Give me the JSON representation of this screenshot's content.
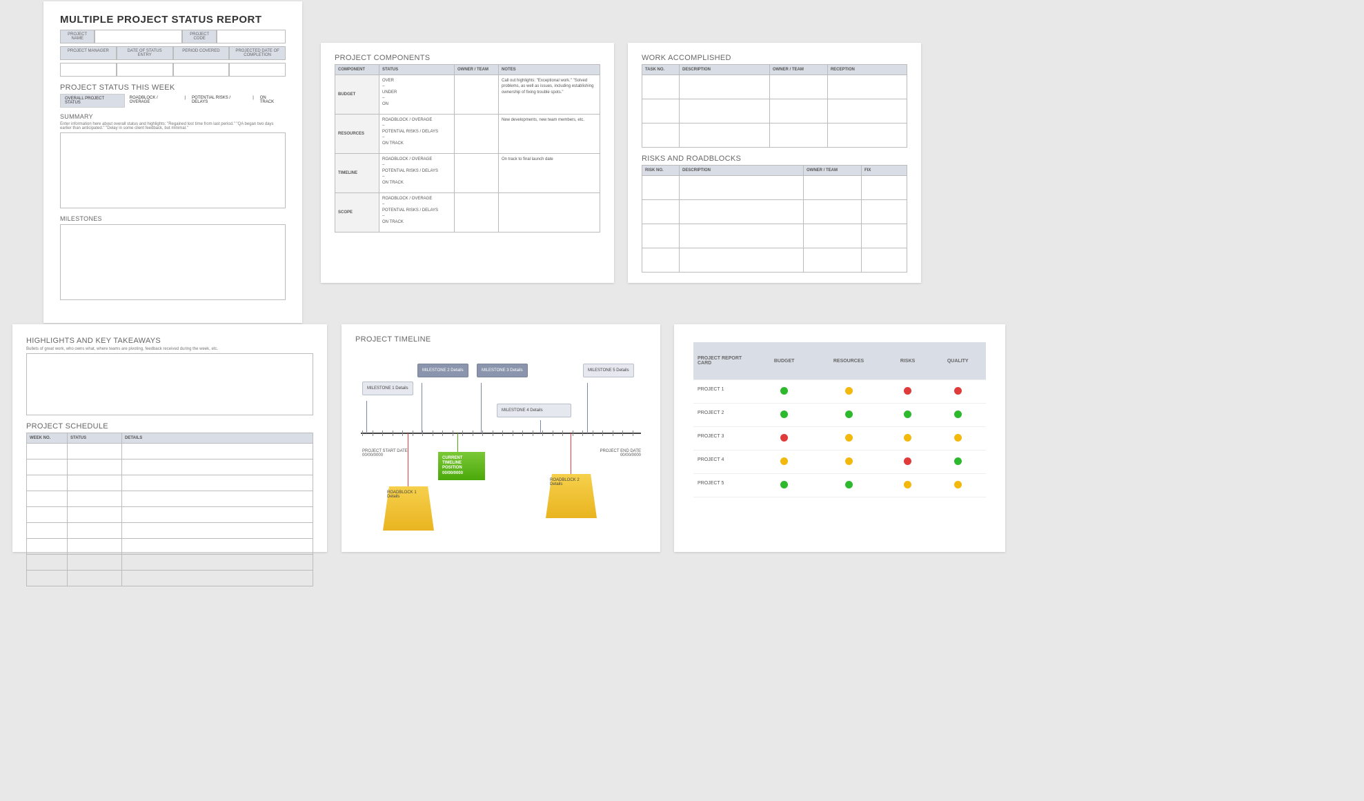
{
  "page1": {
    "title": "MULTIPLE PROJECT STATUS REPORT",
    "hdr": {
      "pname": "PROJECT NAME",
      "pcode": "PROJECT CODE"
    },
    "row2": {
      "pm": "PROJECT MANAGER",
      "date": "DATE OF STATUS ENTRY",
      "period": "PERIOD COVERED",
      "proj": "PROJECTED DATE OF COMPLETION"
    },
    "status_title": "PROJECT STATUS THIS WEEK",
    "tabs": {
      "overall": "OVERALL PROJECT STATUS",
      "road": "ROADBLOCK / OVERAGE",
      "sep1": "|",
      "risks": "POTENTIAL RISKS / DELAYS",
      "sep2": "|",
      "ontrack": "ON TRACK"
    },
    "summary_title": "SUMMARY",
    "summary_hint": "Enter information here about overall status and highlights: \"Regained lost time from last period.\" \"QA began two days earlier than anticipated.\" \"Delay in some client feedback, but minimal.\"",
    "milestones_title": "MILESTONES"
  },
  "page2": {
    "title": "PROJECT COMPONENTS",
    "cols": {
      "c1": "COMPONENT",
      "c2": "STATUS",
      "c3": "OWNER / TEAM",
      "c4": "NOTES"
    },
    "rows": [
      {
        "comp": "BUDGET",
        "status": "OVER\n–\nUNDER\n–\nON",
        "notes": "Call out highlights: \"Exceptional work.\" \"Solved problems, as well as issues, including establishing ownership of fixing trouble spots.\""
      },
      {
        "comp": "RESOURCES",
        "status": "ROADBLOCK / OVERAGE\n–\nPOTENTIAL RISKS / DELAYS\n–\nON TRACK",
        "notes": "New developments, new team members, etc."
      },
      {
        "comp": "TIMELINE",
        "status": "ROADBLOCK / OVERAGE\n–\nPOTENTIAL RISKS / DELAYS\n–\nON TRACK",
        "notes": "On track to final launch date"
      },
      {
        "comp": "SCOPE",
        "status": "ROADBLOCK / OVERAGE\n–\nPOTENTIAL RISKS / DELAYS\n–\nON TRACK",
        "notes": ""
      }
    ]
  },
  "page3": {
    "work_title": "WORK ACCOMPLISHED",
    "work_cols": {
      "c1": "TASK NO.",
      "c2": "DESCRIPTION",
      "c3": "OWNER / TEAM",
      "c4": "RECEPTION"
    },
    "risks_title": "RISKS AND ROADBLOCKS",
    "risks_cols": {
      "c1": "RISK NO.",
      "c2": "DESCRIPTION",
      "c3": "OWNER / TEAM",
      "c4": "FIX"
    }
  },
  "page4": {
    "hl_title": "HIGHLIGHTS AND KEY TAKEAWAYS",
    "hl_hint": "Bullets of great work, who owns what, where teams are pivoting, feedback received during the week, etc.",
    "sched_title": "PROJECT SCHEDULE",
    "sched_cols": {
      "c1": "WEEK NO.",
      "c2": "STATUS",
      "c3": "DETAILS"
    }
  },
  "page5": {
    "title": "PROJECT TIMELINE",
    "ms1": "MILESTONE 1\nDetails",
    "ms2": "MILESTONE 2\nDetails",
    "ms3": "MILESTONE 3\nDetails",
    "ms4": "MILESTONE 4\nDetails",
    "ms5": "MILESTONE 5\nDetails",
    "current": "CURRENT TIMELINE POSITION 00/00/0000",
    "rb1": "ROADBLOCK 1\nDetails",
    "rb2": "ROADBLOCK 2\nDetails",
    "start": "PROJECT START DATE\n00/00/0000",
    "end": "PROJECT END DATE\n00/00/0000"
  },
  "page6": {
    "head": {
      "h0": "PROJECT REPORT CARD",
      "h1": "BUDGET",
      "h2": "RESOURCES",
      "h3": "RISKS",
      "h4": "QUALITY"
    },
    "rows": [
      {
        "name": "PROJECT 1",
        "s": [
          "g",
          "y",
          "r",
          "r"
        ]
      },
      {
        "name": "PROJECT 2",
        "s": [
          "g",
          "g",
          "g",
          "g"
        ]
      },
      {
        "name": "PROJECT 3",
        "s": [
          "r",
          "y",
          "y",
          "y"
        ]
      },
      {
        "name": "PROJECT 4",
        "s": [
          "y",
          "y",
          "r",
          "g"
        ]
      },
      {
        "name": "PROJECT 5",
        "s": [
          "g",
          "g",
          "y",
          "y"
        ]
      }
    ]
  }
}
